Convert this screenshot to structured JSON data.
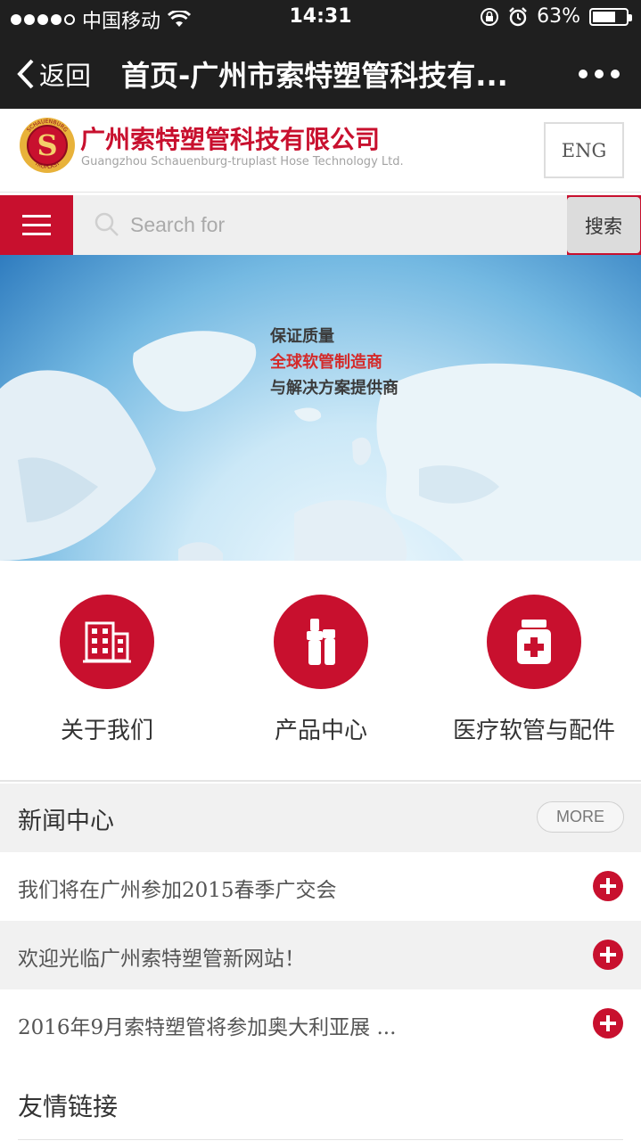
{
  "status_bar": {
    "carrier": "中国移动",
    "time": "14:31",
    "battery": "63%",
    "battery_level": 0.63
  },
  "nav": {
    "back_label": "返回",
    "title": "首页-广州市索特塑管科技有..."
  },
  "header": {
    "company_cn": "广州索特塑管科技有限公司",
    "company_en": "Guangzhou Schauenburg-truplast Hose Technology Ltd.",
    "lang_button": "ENG",
    "logo": {
      "ring_text_top": "SCHAUENBURG",
      "ring_text_bottom": "TRUPLAST",
      "letter": "S"
    }
  },
  "search": {
    "placeholder": "Search for",
    "button_label": "搜索"
  },
  "banner": {
    "slogan_line1": "保证质量",
    "slogan_line2": "全球软管制造商",
    "slogan_line3": "与解决方案提供商",
    "slide_count": 5
  },
  "categories": [
    {
      "label": "关于我们",
      "icon": "building-icon"
    },
    {
      "label": "产品中心",
      "icon": "hose-fitting-icon"
    },
    {
      "label": "医疗软管与配件",
      "icon": "medicine-bottle-icon"
    }
  ],
  "news": {
    "title": "新闻中心",
    "more_label": "MORE",
    "items": [
      {
        "text": "我们将在广州参加2015春季广交会"
      },
      {
        "text": "欢迎光临广州索特塑管新网站！"
      },
      {
        "text": "2016年9月索特塑管将参加奥大利亚展 ..."
      }
    ]
  },
  "links": {
    "title": "友情链接"
  },
  "colors": {
    "brand_red": "#c8102e",
    "bar_dark": "#1f1f1f"
  }
}
